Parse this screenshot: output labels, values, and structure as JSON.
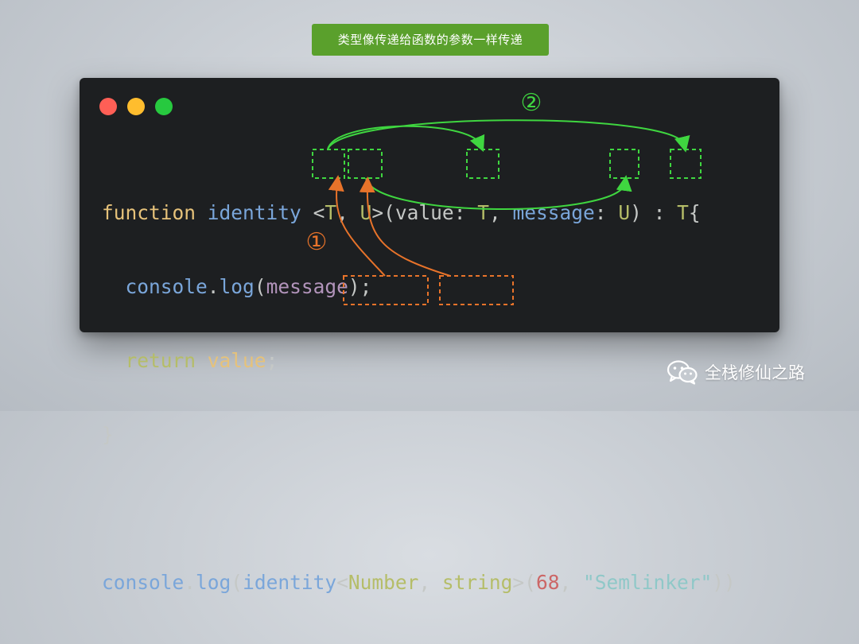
{
  "title": "类型像传递给函数的参数一样传递",
  "window_buttons": [
    "close",
    "minimize",
    "maximize"
  ],
  "code": {
    "line1": {
      "keyword": "function",
      "name": "identity",
      "open": "<",
      "t1": "T",
      "comma1": ",",
      "u1": "U",
      "close": ">",
      "paren": "(",
      "param1": "value",
      "colon1": ":",
      "t2": "T",
      "comma2": ",",
      "param2": "message",
      "colon2": ":",
      "u2": "U",
      "paren_close": ")",
      "colon3": ":",
      "t3": "T",
      "brace": "{"
    },
    "line2": {
      "obj": "console",
      "dot": ".",
      "method": "log",
      "open": "(",
      "arg": "message",
      "close": ");"
    },
    "line3": {
      "keyword": "return",
      "value": "value",
      "semi": ";"
    },
    "line4": {
      "brace": "}"
    },
    "line6": {
      "obj": "console",
      "dot": ".",
      "method": "log",
      "open": "(",
      "fn": "identity",
      "lt": "<",
      "type1": "Number",
      "comma": ",",
      "type2": "string",
      "gt": ">",
      "paren": "(",
      "num": "68",
      "comma2": ",",
      "str": "\"Semlinker\"",
      "close": "))"
    }
  },
  "annotations": {
    "step1": "①",
    "step2": "②",
    "step1_color": "#e8732a",
    "step2_color": "#3fd640"
  },
  "watermark": {
    "icon": "wechat-icon",
    "text": "全栈修仙之路"
  }
}
